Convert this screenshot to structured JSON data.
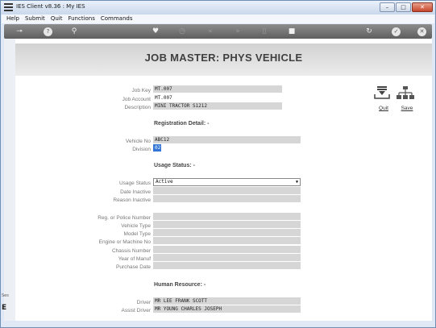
{
  "window": {
    "title": "IES Client v8.36 : My IES",
    "controls": {
      "minimize": "–",
      "maximize": "□",
      "close": "✕"
    }
  },
  "menu": [
    "Help",
    "Submit",
    "Quit",
    "Functions",
    "Commands"
  ],
  "toolbar": {
    "icons": [
      "key-icon",
      "help-icon",
      "search-icon",
      "heart-icon",
      "clock-icon",
      "rewind-icon",
      "fast-forward-icon",
      "document-icon",
      "stop-icon",
      "refresh-icon",
      "check-icon",
      "close-icon"
    ],
    "glyphs": {
      "key": "⊸",
      "help": "?",
      "search": "⚲",
      "heart": "♥",
      "clock": "◷",
      "rewind": "«",
      "forward": "»",
      "document": "▯",
      "stop": "■",
      "refresh": "↻",
      "check": "✓",
      "close": "✕"
    }
  },
  "page": {
    "title": "JOB MASTER: PHYS VEHICLE",
    "actions": {
      "quit": "Quit",
      "save": "Save"
    }
  },
  "fields": {
    "job_key": {
      "label": "Job Key",
      "value": "MT.007"
    },
    "job_account": {
      "label": "Job Account",
      "value": "MT.007"
    },
    "description": {
      "label": "Description",
      "value": "MINI TRACTOR S1212"
    },
    "vehicle_no": {
      "label": "Vehicle No",
      "value": "ABC12"
    },
    "division": {
      "label": "Division",
      "value": "02"
    },
    "usage_status": {
      "label": "Usage Status",
      "value": "Active"
    },
    "date_inactive": {
      "label": "Date Inactive",
      "value": ""
    },
    "reason_inactive": {
      "label": "Reason Inactive",
      "value": ""
    },
    "reg_number": {
      "label": "Reg. or Police Number",
      "value": ""
    },
    "vehicle_type": {
      "label": "Vehicle Type",
      "value": ""
    },
    "model_type": {
      "label": "Model Type",
      "value": ""
    },
    "engine_no": {
      "label": "Engine or Machine No",
      "value": ""
    },
    "chassis_number": {
      "label": "Chassis Number",
      "value": ""
    },
    "year_of_manuf": {
      "label": "Year of Manuf",
      "value": ""
    },
    "purchase_date": {
      "label": "Purchase Date",
      "value": ""
    },
    "driver": {
      "label": "Driver",
      "value": "MR LEE FRANK SCOTT"
    },
    "assist_driver": {
      "label": "Assist Driver",
      "value": "MR YOUNG CHARLES JOSEPH"
    }
  },
  "sections": {
    "registration": "Registration Detail: -",
    "usage": "Usage Status: -",
    "human_resource": "Human Resource: -"
  },
  "side_strip": {
    "label": "Ses",
    "letter": "E"
  }
}
